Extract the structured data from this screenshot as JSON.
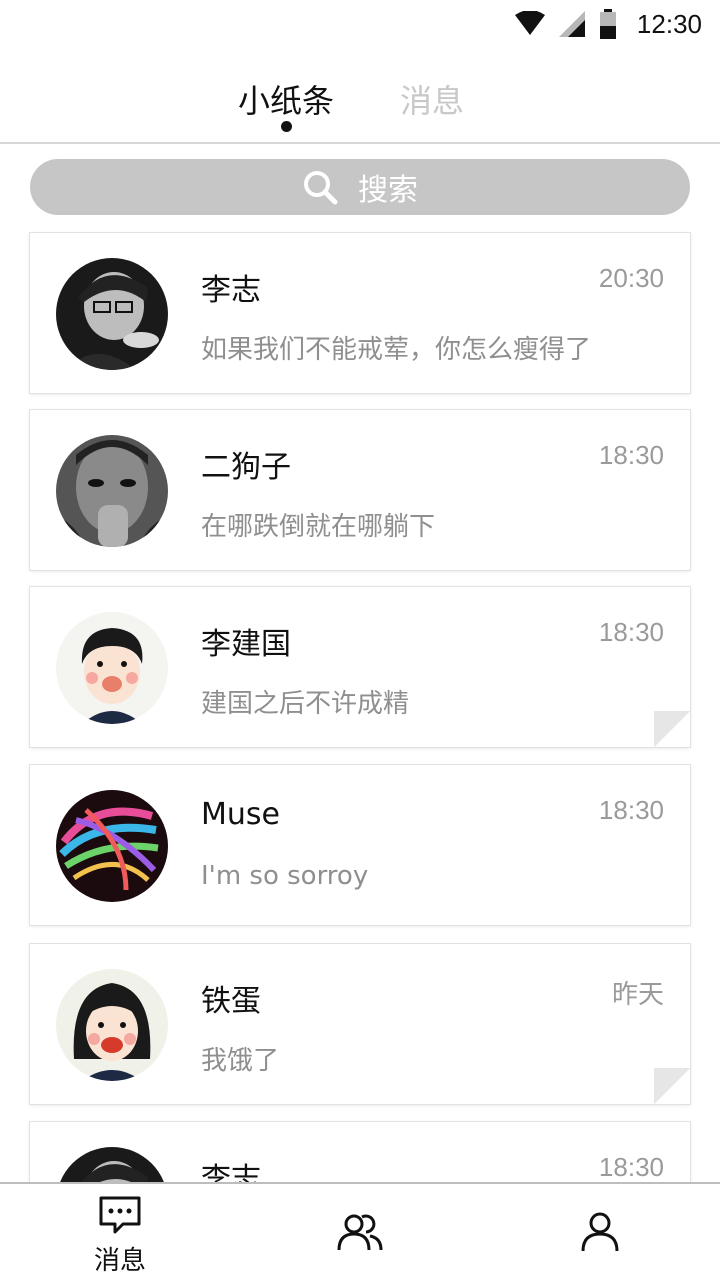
{
  "status_bar": {
    "time": "12:30"
  },
  "top_tabs": {
    "active": "小纸条",
    "inactive": "消息"
  },
  "search": {
    "label": "搜索"
  },
  "conversations": [
    {
      "name": "李志",
      "time": "20:30",
      "preview": "如果我们不能戒荤，你怎么瘦得了",
      "avatar": "man-glasses-bw-avatar"
    },
    {
      "name": "二狗子",
      "time": "18:30",
      "preview": "在哪跌倒就在哪躺下",
      "avatar": "man-hand-face-bw-avatar"
    },
    {
      "name": "李建国",
      "time": "18:30",
      "preview": "建国之后不许成精",
      "avatar": "cartoon-boy-avatar"
    },
    {
      "name": "Muse",
      "time": "18:30",
      "preview": "I'm so sorroy",
      "avatar": "colorful-fibers-avatar"
    },
    {
      "name": "铁蛋",
      "time": "昨天",
      "preview": "我饿了",
      "avatar": "cartoon-girl-avatar"
    },
    {
      "name": "李志",
      "time": "18:30",
      "preview": "",
      "avatar": "man-glasses-bw-avatar"
    }
  ],
  "bottom_nav": {
    "messages_label": "消息"
  },
  "colors": {
    "search_bg": "#c6c6c6",
    "muted_text": "#8f8f8f",
    "inactive_tab": "#c8c8c8"
  }
}
